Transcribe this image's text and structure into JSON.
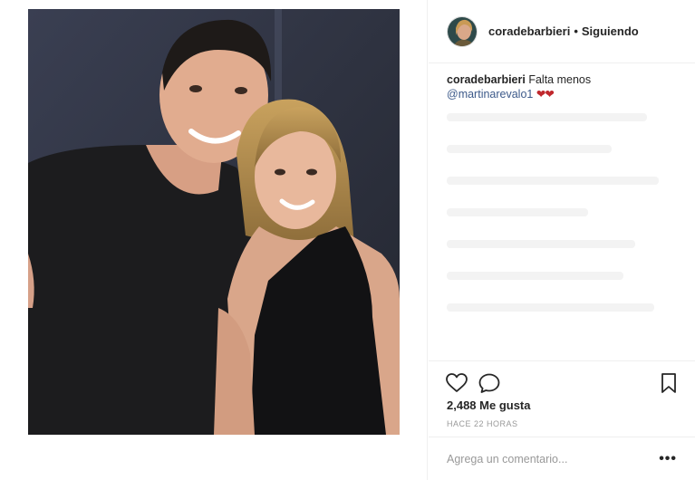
{
  "post": {
    "image_alt": "",
    "author": {
      "username": "coradebarbieri",
      "separator": "•",
      "follow_status": "Siguiendo"
    },
    "caption": {
      "username": "coradebarbieri",
      "text": "Falta menos",
      "mention": "@martinarevalo1",
      "emoji": "❤❤"
    },
    "actions": {
      "like_icon": "heart-outline-icon",
      "comment_icon": "speech-bubble-icon",
      "save_icon": "bookmark-icon"
    },
    "likes": "2,488 Me gusta",
    "timestamp": "HACE 22 HORAS",
    "comment_box": {
      "placeholder": "Agrega un comentario...",
      "more": "•••"
    }
  }
}
